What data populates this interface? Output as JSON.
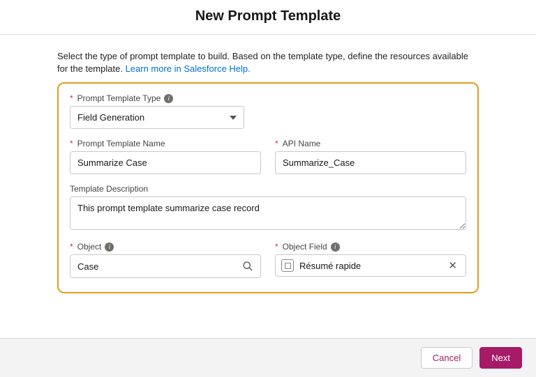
{
  "modal": {
    "title": "New Prompt Template"
  },
  "intro": {
    "text": "Select the type of prompt template to build. Based on the template type, define the resources available for the template. ",
    "linkText": "Learn more in Salesforce Help."
  },
  "labels": {
    "templateType": "Prompt Template Type",
    "templateName": "Prompt Template Name",
    "apiName": "API Name",
    "description": "Template Description",
    "object": "Object",
    "objectField": "Object Field"
  },
  "values": {
    "templateType": "Field Generation",
    "templateName": "Summarize Case",
    "apiName": "Summarize_Case",
    "description": "This prompt template summarize case record",
    "object": "Case",
    "objectField": "Résumé rapide"
  },
  "buttons": {
    "cancel": "Cancel",
    "next": "Next"
  }
}
